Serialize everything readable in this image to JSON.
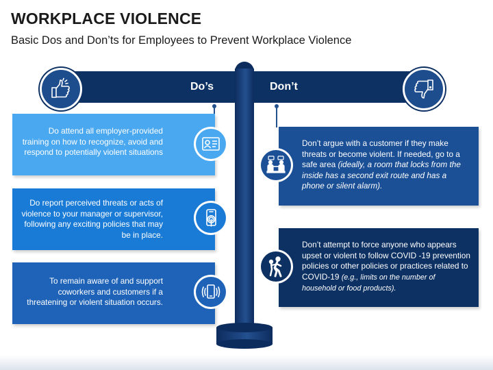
{
  "title": "WORKPLACE VIOLENCE",
  "subtitle": "Basic Dos and Don’ts for Employees to Prevent Workplace Violence",
  "signpost": {
    "dos_label": "Do’s",
    "donts_label": "Don’t",
    "dos_icon": "thumbs-up-icon",
    "donts_icon": "thumbs-down-icon"
  },
  "dos": [
    {
      "text": "Do attend all employer-provided training on how to recognize, avoid and respond to potentially violent situations",
      "icon": "id-card-icon",
      "color": "#4aa8f0"
    },
    {
      "text": "Do report perceived threats or acts of violence to your manager or supervisor, following any exciting policies that may be in place.",
      "icon": "smartphone-touch-icon",
      "color": "#1a7bd6"
    },
    {
      "text": "To remain aware of and support coworkers and customers if a threatening or violent situation occurs.",
      "icon": "phone-alert-icon",
      "color": "#1e63b8"
    }
  ],
  "donts": [
    {
      "text": "Don’t argue with a customer if they make threats or become violent. If needed, go to a safe area ",
      "italic": "(ideally, a room that locks from the inside has a second exit route and has a phone or silent alarm).",
      "icon": "argument-icon",
      "color": "#1b4f96"
    },
    {
      "text": "Don’t attempt to force anyone who appears upset or violent to follow COVID -19 prevention policies or other policies or practices related to COVID-19 ",
      "italic": "(e.g., limits on the number of household or food products).",
      "icon": "force-icon",
      "color": "#0d3163"
    }
  ]
}
